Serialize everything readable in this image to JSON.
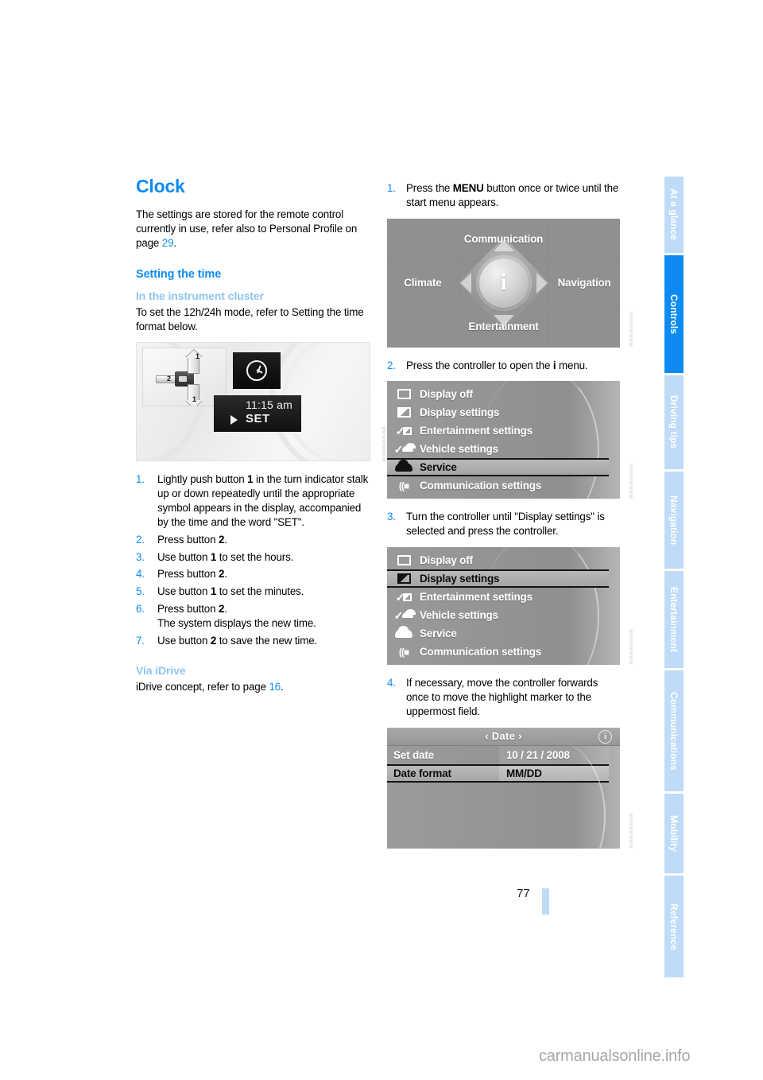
{
  "page": {
    "number": "77",
    "watermark": "carmanualsonline.info"
  },
  "sidebar": {
    "tabs": [
      {
        "label": "At a glance",
        "active": false
      },
      {
        "label": "Controls",
        "active": true
      },
      {
        "label": "Driving tips",
        "active": false
      },
      {
        "label": "Navigation",
        "active": false
      },
      {
        "label": "Entertainment",
        "active": false
      },
      {
        "label": "Communications",
        "active": false
      },
      {
        "label": "Mobility",
        "active": false
      },
      {
        "label": "Reference",
        "active": false
      }
    ]
  },
  "left_column": {
    "chapter_title": "Clock",
    "intro_before_ref": "The settings are stored for the remote control currently in use, refer also to Personal Profile on page ",
    "intro_ref": "29",
    "intro_after_ref": ".",
    "section_title": "Setting the time",
    "subsection_title": "In the instrument cluster",
    "subsection_text": "To set the 12h/24h mode, refer to Setting the time format below.",
    "cluster_figure": {
      "label_1_top": "1",
      "label_1_bottom": "1",
      "label_2": "2",
      "display_time": "11:15 am",
      "display_set": "SET",
      "credit": "WWWWWWWW"
    },
    "steps": [
      {
        "num": "1.",
        "parts": [
          {
            "t": "Lightly push button "
          },
          {
            "t": "1",
            "b": true
          },
          {
            "t": " in the turn indicator stalk up or down repeatedly until the appropriate symbol appears in the display, accompanied by the time and the word \"SET\"."
          }
        ]
      },
      {
        "num": "2.",
        "parts": [
          {
            "t": "Press button "
          },
          {
            "t": "2",
            "b": true
          },
          {
            "t": "."
          }
        ]
      },
      {
        "num": "3.",
        "parts": [
          {
            "t": "Use button "
          },
          {
            "t": "1",
            "b": true
          },
          {
            "t": " to set the hours."
          }
        ]
      },
      {
        "num": "4.",
        "parts": [
          {
            "t": "Press button "
          },
          {
            "t": "2",
            "b": true
          },
          {
            "t": "."
          }
        ]
      },
      {
        "num": "5.",
        "parts": [
          {
            "t": "Use button "
          },
          {
            "t": "1",
            "b": true
          },
          {
            "t": " to set the minutes."
          }
        ]
      },
      {
        "num": "6.",
        "parts": [
          {
            "t": "Press button "
          },
          {
            "t": "2",
            "b": true
          },
          {
            "t": ".\nThe system displays the new time."
          }
        ]
      },
      {
        "num": "7.",
        "parts": [
          {
            "t": "Use button "
          },
          {
            "t": "2",
            "b": true
          },
          {
            "t": " to save the new time."
          }
        ]
      }
    ],
    "idrive_subsection_title": "Via iDrive",
    "idrive_text_before_ref": "iDrive concept, refer to page ",
    "idrive_ref": "16",
    "idrive_text_after_ref": "."
  },
  "right_column": {
    "step1": {
      "num": "1.",
      "text_before_bold": "Press the ",
      "bold": "MENU",
      "text_after_bold": " button once or twice until the start menu appears."
    },
    "start_menu": {
      "top": "Communication",
      "left": "Climate",
      "right": "Navigation",
      "bottom": "Entertainment",
      "center_icon": "i",
      "credit": "WWWWWWWW"
    },
    "step2": {
      "num": "2.",
      "text_before_bold": "Press the controller to open the ",
      "bold": "i",
      "text_after_bold": " menu."
    },
    "i_menu": {
      "items": [
        {
          "label": "Display off",
          "icon": "screen-off-icon",
          "selected": false
        },
        {
          "label": "Display settings",
          "icon": "display-settings-icon",
          "selected": false
        },
        {
          "label": "Entertainment settings",
          "icon": "entertainment-settings-icon",
          "selected": false
        },
        {
          "label": "Vehicle settings",
          "icon": "vehicle-settings-icon",
          "selected": false
        },
        {
          "label": "Service",
          "icon": "service-car-icon",
          "selected": true
        },
        {
          "label": "Communication settings",
          "icon": "communication-settings-icon",
          "selected": false
        }
      ],
      "credit": "WWWWWWWW"
    },
    "step3": {
      "num": "3.",
      "text": "Turn the controller until \"Display settings\" is selected and press the controller."
    },
    "display_menu": {
      "items": [
        {
          "label": "Display off",
          "icon": "screen-off-icon",
          "selected": false
        },
        {
          "label": "Display settings",
          "icon": "display-settings-icon",
          "selected": true
        },
        {
          "label": "Entertainment settings",
          "icon": "entertainment-settings-icon",
          "selected": false
        },
        {
          "label": "Vehicle settings",
          "icon": "vehicle-settings-icon",
          "selected": false
        },
        {
          "label": "Service",
          "icon": "service-car-icon",
          "selected": false
        },
        {
          "label": "Communication settings",
          "icon": "communication-settings-icon",
          "selected": false
        }
      ],
      "credit": "WWWWWWWW"
    },
    "step4": {
      "num": "4.",
      "text": "If necessary, move the controller forwards once to move the highlight marker to the uppermost field."
    },
    "date_screen": {
      "header_title": "‹ Date ›",
      "info_icon": "i",
      "rows": [
        {
          "key": "Set date",
          "value": "10 / 21 / 2008",
          "selected": false
        },
        {
          "key": "Date format",
          "value": "MM/DD",
          "selected": true
        }
      ],
      "credit": "WWWWWWWW"
    }
  },
  "colors": {
    "accent_blue": "#0d8bf2",
    "light_blue": "#8fc4f0",
    "tab_inactive": "#bfdbf7",
    "screen_gray": "#909090"
  }
}
